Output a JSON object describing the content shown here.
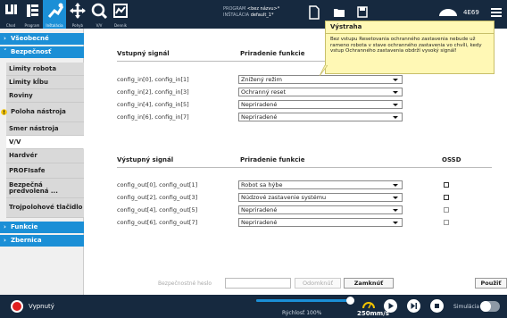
{
  "header": {
    "nav": [
      {
        "label": "Chod",
        "icon": "ur-logo-icon"
      },
      {
        "label": "Program",
        "icon": "program-icon"
      },
      {
        "label": "Inštalácia",
        "icon": "installation-icon",
        "active": true
      },
      {
        "label": "Pohyb",
        "icon": "move-icon"
      },
      {
        "label": "V/V",
        "icon": "io-icon"
      },
      {
        "label": "Denník",
        "icon": "log-icon"
      }
    ],
    "program_label": "PROGRAM",
    "program_value": "<bez názvu>*",
    "installation_label": "INŠTALÁCIA",
    "installation_value": "default_1*",
    "speed_badge": "4E69",
    "accent": "#1b8fd6",
    "bar_color": "#16293f"
  },
  "sidebar": {
    "categories": [
      {
        "label": "Všeobecné",
        "expanded": false
      },
      {
        "label": "Bezpečnosť",
        "expanded": true
      },
      {
        "label": "Funkcie",
        "expanded": false
      },
      {
        "label": "Zbernica",
        "expanded": false
      }
    ],
    "items": [
      {
        "label": "Limity robota"
      },
      {
        "label": "Limity kĺbu"
      },
      {
        "label": "Roviny"
      },
      {
        "label": "Poloha nástroja",
        "warning": true
      },
      {
        "label": "Smer nástroja"
      },
      {
        "label": "V/V",
        "selected": true
      },
      {
        "label": "Hardvér"
      },
      {
        "label": "PROFIsafe"
      },
      {
        "label": "Bezpečná predvolená ..."
      },
      {
        "label": "Trojpolohové tlačidlo"
      }
    ]
  },
  "inputs": {
    "col_signal": "Vstupný signál",
    "col_function": "Priradenie funkcie",
    "rows": [
      {
        "signal": "config_in[0], config_in[1]",
        "function": "Znížený režim"
      },
      {
        "signal": "config_in[2], config_in[3]",
        "function": "Ochranný reset"
      },
      {
        "signal": "config_in[4], config_in[5]",
        "function": "Nepriradené"
      },
      {
        "signal": "config_in[6], config_in[7]",
        "function": "Nepriradené"
      }
    ]
  },
  "outputs": {
    "col_signal": "Výstupný signál",
    "col_function": "Priradenie funkcie",
    "col_ossd": "OSSD",
    "rows": [
      {
        "signal": "config_out[0], config_out[1]",
        "function": "Robot sa hýbe",
        "ossd": false
      },
      {
        "signal": "config_out[2], config_out[3]",
        "function": "Núdzové zastavenie systému",
        "ossd": false
      },
      {
        "signal": "config_out[4], config_out[5]",
        "function": "Nepriradené",
        "ossd": false
      },
      {
        "signal": "config_out[6], config_out[7]",
        "function": "Nepriradené",
        "ossd": false
      }
    ]
  },
  "tooltip": {
    "title": "Výstraha",
    "text": "Bez vstupu Resetovania ochranného zastavenia nebude už rameno robota v stave ochranného zastavenia vo chvíli, kedy vstup Ochranného zastavenia obdrží vysoký signál!",
    "background": "#fff8b5"
  },
  "password_bar": {
    "label": "Bezpečnostné heslo",
    "placeholder": "",
    "unlock": "Odomknúť",
    "lock": "Zamknúť",
    "apply": "Použiť"
  },
  "footer": {
    "power": "Vypnutý",
    "speed_label": "Rýchlosť 100%",
    "speed_fraction": 1.0,
    "velocity": "250mm/s",
    "sim_label": "Simulácia",
    "power_color": "#e02020"
  }
}
